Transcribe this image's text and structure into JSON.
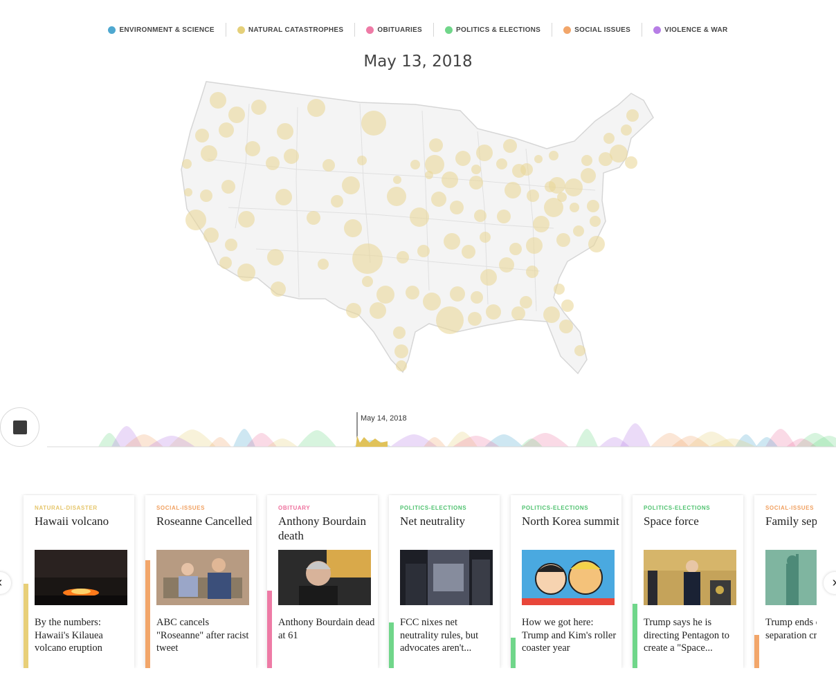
{
  "legend": [
    {
      "label": "ENVIRONMENT & SCIENCE",
      "color": "#4ea8d0"
    },
    {
      "label": "NATURAL CATASTROPHES",
      "color": "#e5d07a"
    },
    {
      "label": "OBITUARIES",
      "color": "#ee7ba6"
    },
    {
      "label": "POLITICS & ELECTIONS",
      "color": "#70d68a"
    },
    {
      "label": "SOCIAL ISSUES",
      "color": "#f2a66a"
    },
    {
      "label": "VIOLENCE & WAR",
      "color": "#b77ee6"
    }
  ],
  "map": {
    "date": "May 13, 2018",
    "bubble_color": "#ead79a"
  },
  "timeline": {
    "current_label": "May 14, 2018",
    "play_icon": "stop-icon"
  },
  "cards": [
    {
      "category": "NATURAL-DISASTER",
      "category_color": "#e5c56a",
      "title": "Hawaii volcano",
      "description": "By the numbers: Hawaii's Kilauea volcano eruption",
      "bar_color": "#e8cf78",
      "bar_fraction": 0.72,
      "image": "volcano-image"
    },
    {
      "category": "SOCIAL-ISSUES",
      "category_color": "#f0a060",
      "title": "Roseanne Cancelled",
      "description": "ABC cancels \"Roseanne\" after racist tweet",
      "bar_color": "#f2a66a",
      "bar_fraction": 0.92,
      "image": "sitcom-couple-image"
    },
    {
      "category": "OBITUARY",
      "category_color": "#ee6f9c",
      "title": "Anthony Bourdain death",
      "description": "Anthony Bourdain dead at 61",
      "bar_color": "#ee7ba6",
      "bar_fraction": 0.66,
      "image": "portrait-image"
    },
    {
      "category": "POLITICS-ELECTIONS",
      "category_color": "#4fc26f",
      "title": "Net neutrality",
      "description": "FCC nixes net neutrality rules, but advocates aren't...",
      "bar_color": "#70d68a",
      "bar_fraction": 0.39,
      "image": "projection-building-image"
    },
    {
      "category": "POLITICS-ELECTIONS",
      "category_color": "#4fc26f",
      "title": "North Korea summit",
      "description": "How we got here: Trump and Kim's roller coaster year",
      "bar_color": "#70d68a",
      "bar_fraction": 0.26,
      "image": "cartoon-leaders-image"
    },
    {
      "category": "POLITICS-ELECTIONS",
      "category_color": "#4fc26f",
      "title": "Space force",
      "description": "Trump says he is directing Pentagon to create a \"Space...",
      "bar_color": "#70d68a",
      "bar_fraction": 0.55,
      "image": "podium-speech-image"
    },
    {
      "category": "SOCIAL-ISSUES",
      "category_color": "#f0a060",
      "title": "Family separations",
      "description": "Trump ends child separation crisis of his",
      "bar_color": "#f2a66a",
      "bar_fraction": 0.28,
      "image": "statue-image"
    }
  ],
  "nav": {
    "prev": "‹",
    "next": "›"
  }
}
